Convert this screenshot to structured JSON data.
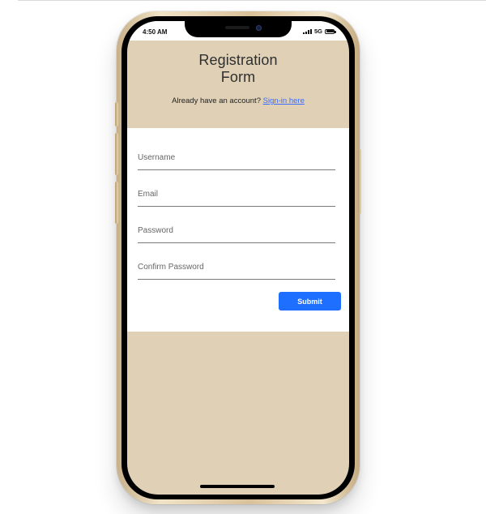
{
  "status_bar": {
    "time": "4:50 AM",
    "network": "5G",
    "icons": [
      "signal-bars-icon",
      "battery-icon"
    ]
  },
  "header": {
    "title": "Registration\nForm",
    "account_prompt": "Already have an account?",
    "sign_in_link": "Sign-in here"
  },
  "form": {
    "username_placeholder": "Username",
    "email_placeholder": "Email",
    "password_placeholder": "Password",
    "confirm_password_placeholder": "Confirm Password",
    "submit_label": "Submit"
  },
  "colors": {
    "accent": "#1e6fff",
    "screen_background": "#dfd0b6",
    "phone_frame": "#d9c19a"
  }
}
